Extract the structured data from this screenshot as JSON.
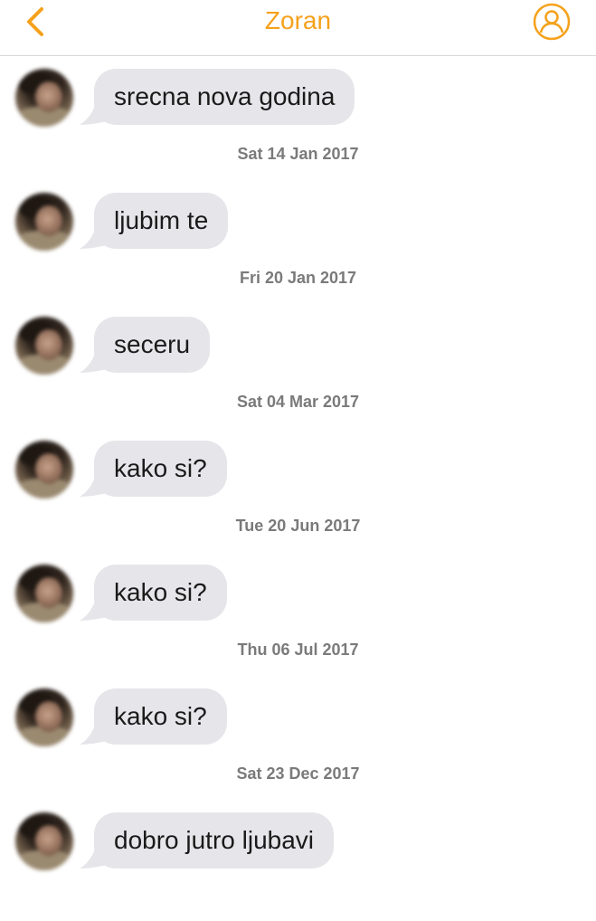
{
  "header": {
    "title": "Zoran",
    "back_icon": "chevron-left-icon",
    "profile_icon": "user-circle-icon",
    "accent_color": "#f5a11b"
  },
  "messages": [
    {
      "text": "srecna nova godina",
      "timestamp": "Sat 14 Jan 2017"
    },
    {
      "text": "ljubim te",
      "timestamp": "Fri 20 Jan 2017"
    },
    {
      "text": "seceru",
      "timestamp": "Sat 04 Mar 2017"
    },
    {
      "text": "kako si?",
      "timestamp": "Tue 20 Jun 2017"
    },
    {
      "text": "kako si?",
      "timestamp": "Thu 06 Jul 2017"
    },
    {
      "text": "kako si?",
      "timestamp": "Sat 23 Dec 2017"
    },
    {
      "text": "dobro jutro ljubavi",
      "timestamp": ""
    }
  ]
}
